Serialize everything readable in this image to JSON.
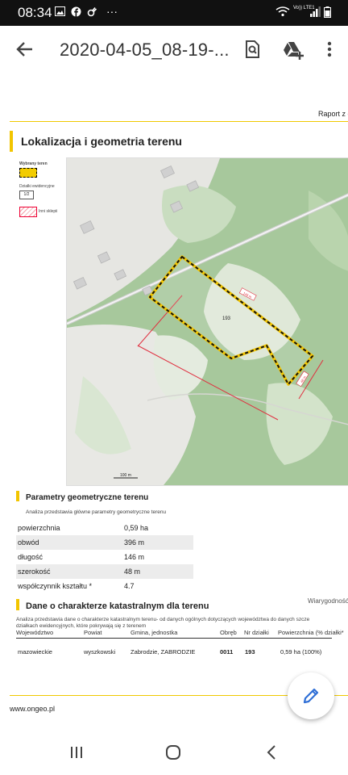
{
  "status_bar": {
    "time": "08:34",
    "network_label": "Vo)) LTE1"
  },
  "app_bar": {
    "title": "2020-04-05_08-19-..."
  },
  "report": {
    "header_right": "Raport z d",
    "section1_title": "Lokalizacja i geometria terenu",
    "legend": {
      "item1": "Wybrany teren",
      "item2": "Działki ewidencyjne",
      "item2_sample": "1/2",
      "item3": "Inni sklepii"
    },
    "map": {
      "parcel_label": "193",
      "dim_long": "146 m",
      "dim_short": "48 m",
      "scale": "100 m"
    },
    "params": {
      "title": "Parametry geometryczne terenu",
      "desc": "Analiza przedstawia główne parametry geometryczne terenu",
      "rows": [
        {
          "key": "powierzchnia",
          "value": "0,59 ha"
        },
        {
          "key": "obwód",
          "value": "396 m"
        },
        {
          "key": "długość",
          "value": "146 m"
        },
        {
          "key": "szerokość",
          "value": "48 m"
        },
        {
          "key": "współczynnik kształtu *",
          "value": "4.7"
        }
      ]
    },
    "reliability": "Wiarygodność",
    "cadastral": {
      "title": "Dane o charakterze katastralnym dla terenu",
      "desc1": "Analiza przedstawia dane o charakterze katastralnym terenu- od danych ogólnych dotyczących województwa do danych szcze",
      "desc2": "działkach ewidencyjnych, które pokrywają się z terenem",
      "headers": [
        "Województwo",
        "Powiat",
        "Gmina, jednostka",
        "Obręb",
        "Nr działki",
        "Powierzchnia (% działki*"
      ],
      "row": [
        "mazowieckie",
        "wyszkowski",
        "Zabrodzie, ZABRODZIE",
        "0011",
        "193",
        "0,59 ha (100%)"
      ]
    },
    "footer_url": "www.ongeo.pl"
  }
}
